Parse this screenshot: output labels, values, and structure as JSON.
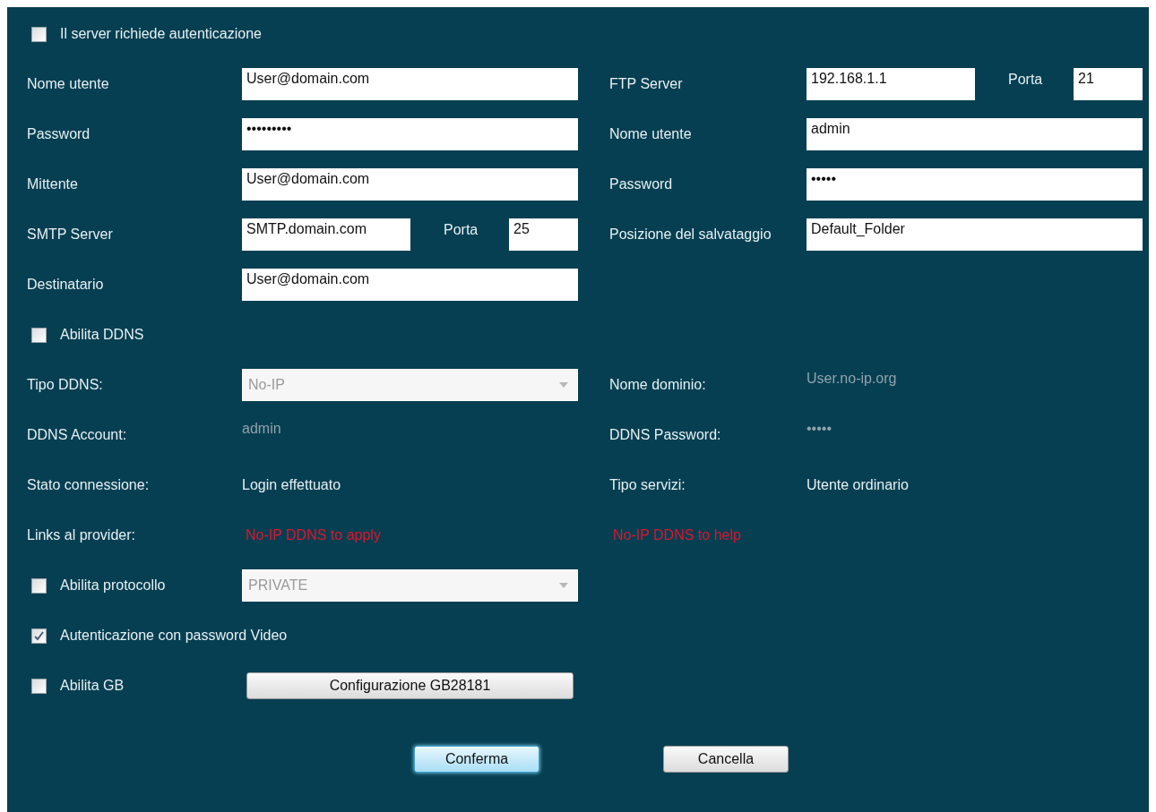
{
  "server_auth": {
    "label": "Il server richiede autenticazione",
    "checked": false
  },
  "email_fields": [
    {
      "kind": "text",
      "label": "Nome utente",
      "value": "User@domain.com"
    },
    {
      "kind": "text",
      "label": "Password",
      "value": "•••••••••"
    },
    {
      "kind": "text",
      "label": "Mittente",
      "value": "User@domain.com"
    },
    {
      "kind": "server",
      "label": "SMTP Server",
      "value": "SMTP.domain.com",
      "port_label": "Porta",
      "port": "25"
    },
    {
      "kind": "text",
      "label": "Destinatario",
      "value": "User@domain.com"
    }
  ],
  "ftp_fields": [
    {
      "kind": "server",
      "label": "FTP Server",
      "value": "192.168.1.1",
      "port_label": "Porta",
      "port": "21"
    },
    {
      "kind": "text",
      "label": "Nome utente",
      "value": "admin"
    },
    {
      "kind": "text",
      "label": "Password",
      "value": "•••••"
    },
    {
      "kind": "text",
      "label": "Posizione del salvataggio",
      "value": "Default_Folder"
    }
  ],
  "ddns_enable": {
    "label": "Abilita DDNS",
    "checked": false
  },
  "ddns_items": [
    {
      "kind": "select",
      "label": "Tipo DDNS:",
      "value": "No-IP",
      "disabled": true
    },
    {
      "kind": "value",
      "label": "Nome dominio:",
      "value": "User.no-ip.org",
      "disabled": true
    },
    {
      "kind": "value",
      "label": "DDNS Account:",
      "value": "admin",
      "disabled": true
    },
    {
      "kind": "value",
      "label": "DDNS Password:",
      "value": "•••••",
      "disabled": true
    },
    {
      "kind": "value",
      "label": "Stato connessione:",
      "value": "Login effettuato",
      "disabled": false
    },
    {
      "kind": "value",
      "label": "Tipo servizi:",
      "value": "Utente ordinario",
      "disabled": false
    }
  ],
  "provider_links": {
    "label": "Links al provider:",
    "links": [
      "No-IP DDNS to apply",
      "No-IP DDNS to help"
    ]
  },
  "protocol": {
    "label": "Abilita protocollo",
    "checked": false,
    "value": "PRIVATE",
    "disabled": true
  },
  "video_auth": {
    "label": "Autenticazione con password Video",
    "checked": true
  },
  "gb": {
    "label": "Abilita GB",
    "checked": false,
    "button": "Configurazione GB28181"
  },
  "buttons": [
    {
      "label": "Conferma",
      "focused": true
    },
    {
      "label": "Cancella",
      "focused": false
    }
  ]
}
